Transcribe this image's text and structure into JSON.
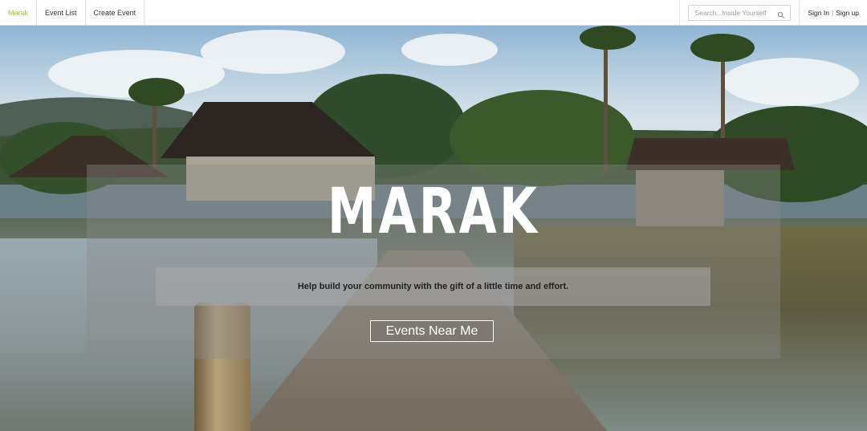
{
  "nav": {
    "brand": "Marak",
    "items": [
      {
        "label": "Event List"
      },
      {
        "label": "Create Event"
      }
    ],
    "search": {
      "placeholder": "Search...Inside Yourself",
      "value": "",
      "icon": "search-icon"
    },
    "auth": {
      "sign_in": "Sign In",
      "separator": "|",
      "sign_up": "Sign up"
    }
  },
  "hero": {
    "title": "MARAK",
    "tagline": "Help build your community with the gift of a little time and effort.",
    "cta_label": "Events Near Me"
  },
  "colors": {
    "brand_accent": "#9bc53d",
    "nav_background": "#ffffff",
    "title_text": "#ffffff"
  }
}
